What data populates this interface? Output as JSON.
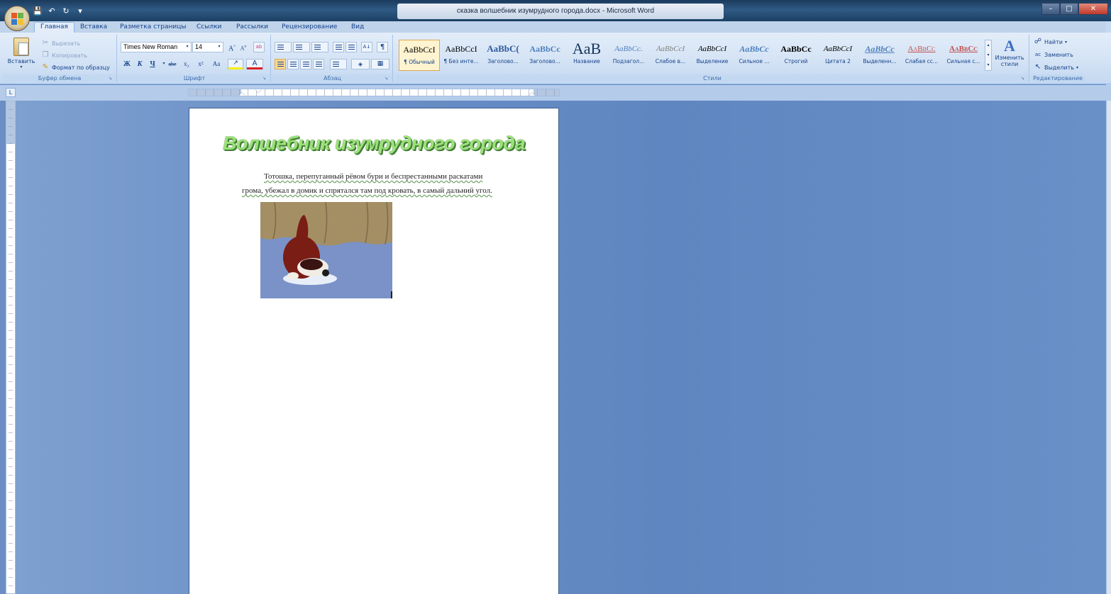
{
  "window": {
    "title": "сказка  волшебник изумрудного города.docx - Microsoft Word",
    "minimize_icon": "minimize-icon",
    "maximize_icon": "maximize-icon",
    "close_icon": "close-icon"
  },
  "qat": {
    "save_icon": "save-icon",
    "undo_icon": "undo-icon",
    "redo_icon": "redo-icon"
  },
  "tabs": [
    {
      "label": "Главная",
      "active": true
    },
    {
      "label": "Вставка"
    },
    {
      "label": "Разметка страницы"
    },
    {
      "label": "Ссылки"
    },
    {
      "label": "Рассылки"
    },
    {
      "label": "Рецензирование"
    },
    {
      "label": "Вид"
    }
  ],
  "clipboard": {
    "paste_label": "Вставить",
    "cut_label": "Вырезать",
    "copy_label": "Копировать",
    "format_painter_label": "Формат по образцу",
    "group_name": "Буфер обмена"
  },
  "font": {
    "name": "Times New Roman",
    "size": "14",
    "group_name": "Шрифт",
    "bold": "Ж",
    "italic": "К",
    "underline": "Ч",
    "strike": "abe",
    "subscript": "x₂",
    "superscript": "x²",
    "change_case": "Aa",
    "grow": "A",
    "shrink": "A"
  },
  "paragraph": {
    "group_name": "Абзац"
  },
  "styles": {
    "group_name": "Стили",
    "items": [
      {
        "sample": "AaBbCcI",
        "name": "¶ Обычный"
      },
      {
        "sample": "AaBbCcI",
        "name": "¶ Без инте..."
      },
      {
        "sample": "AaBbC(",
        "name": "Заголово..."
      },
      {
        "sample": "AaBbCc",
        "name": "Заголово..."
      },
      {
        "sample": "AaB",
        "name": "Название"
      },
      {
        "sample": "AaBbCc.",
        "name": "Подзагол..."
      },
      {
        "sample": "AaBbCcI",
        "name": "Слабое в..."
      },
      {
        "sample": "AaBbCcI",
        "name": "Выделение"
      },
      {
        "sample": "AaBbCc",
        "name": "Сильное ..."
      },
      {
        "sample": "AaBbCc",
        "name": "Строгий"
      },
      {
        "sample": "AaBbCcI",
        "name": "Цитата 2"
      },
      {
        "sample": "AaBbCc",
        "name": "Выделенн..."
      },
      {
        "sample": "AaBbCc",
        "name": "Слабая сс..."
      },
      {
        "sample": "AaBbCc",
        "name": "Сильная с..."
      }
    ],
    "change_styles_line1": "Изменить",
    "change_styles_line2": "стили"
  },
  "editing": {
    "group_name": "Редактирование",
    "find_label": "Найти",
    "replace_label": "Заменить",
    "select_label": "Выделить"
  },
  "document": {
    "title": "Волшебник изумрудного города",
    "line1": "Тотошка, перепуганный рёвом бури и беспрестанными раскатами",
    "line2": "грома, убежал в домик и спрятался там под кровать, в самый дальний угол."
  }
}
